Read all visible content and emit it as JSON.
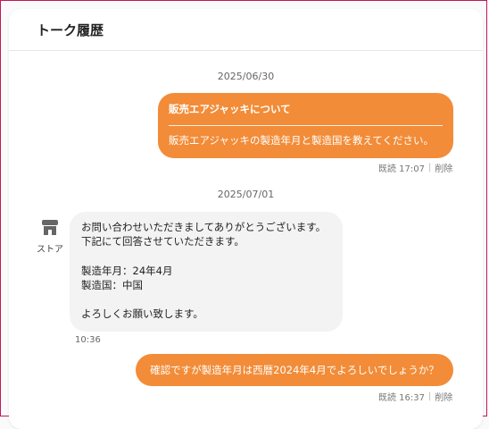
{
  "header": {
    "title": "トーク履歴"
  },
  "messages": [
    {
      "date": "2025/06/30",
      "subject": "販売エアジャッキについて",
      "body": "販売エアジャッキの製造年月と製造国を教えてください。",
      "status": "既読 17:07",
      "delete_label": "削除"
    },
    {
      "date": "2025/07/01",
      "sender_label": "ストア",
      "sender_icon": "store-icon",
      "lines": [
        "お問い合わせいただきましてありがとうございます。",
        "下記にて回答させていただきます。",
        "",
        "製造年月：24年4月",
        "製造国：中国",
        "",
        "よろしくお願い致します。"
      ],
      "time": "10:36"
    },
    {
      "body": "確認ですが製造年月は西暦2024年4月でよろしいでしょうか？",
      "status": "既読 16:37",
      "delete_label": "削除"
    }
  ],
  "colors": {
    "accent": "#f28c38",
    "incoming_bg": "#f3f3f3",
    "border": "#c2185b"
  }
}
